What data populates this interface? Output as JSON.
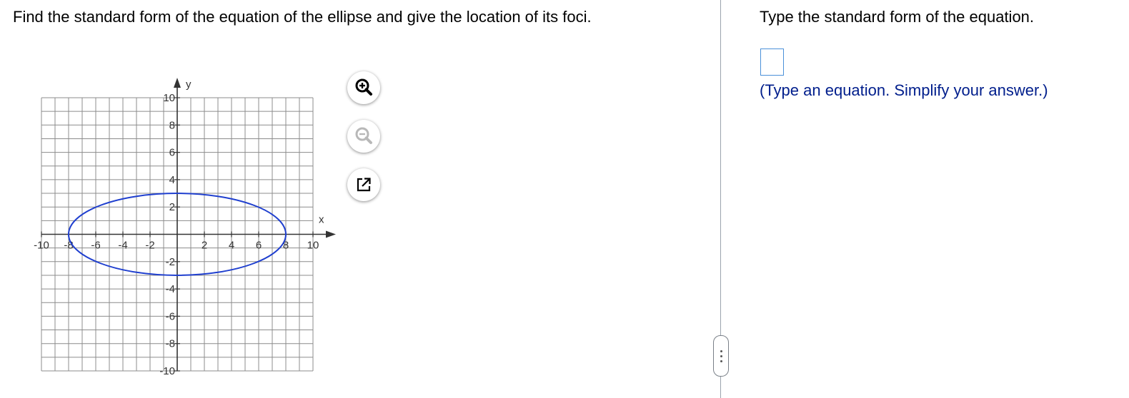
{
  "question": {
    "text": "Find the standard form of the equation of the ellipse and give the location of its foci."
  },
  "graph": {
    "x_axis_label": "x",
    "y_axis_label": "y",
    "x_tick_labels": [
      "-10",
      "-8",
      "-6",
      "-4",
      "-2",
      "2",
      "4",
      "6",
      "8",
      "10"
    ],
    "y_tick_labels": [
      "10",
      "8",
      "6",
      "4",
      "2",
      "-2",
      "-4",
      "-6",
      "-8",
      "-10"
    ],
    "x_range": [
      -10,
      10
    ],
    "y_range": [
      -10,
      10
    ],
    "grid_step": 1,
    "ellipse": {
      "center": [
        0,
        0
      ],
      "semi_axis_x": 8,
      "semi_axis_y": 3,
      "color": "#1f3fcf"
    },
    "colors": {
      "grid": "#8c8c8c",
      "axis": "#333333"
    }
  },
  "tools": {
    "zoom_in_icon": "magnifier-plus-icon",
    "zoom_out_icon": "magnifier-minus-icon",
    "popout_icon": "external-window-icon"
  },
  "right_panel": {
    "prompt": "Type the standard form of the equation.",
    "hint": "(Type an equation. Simplify your answer.)",
    "answer_value": ""
  },
  "colors": {
    "hint_text": "#001e8c",
    "input_border": "#4a90d9",
    "divider": "#9aa3ad"
  }
}
